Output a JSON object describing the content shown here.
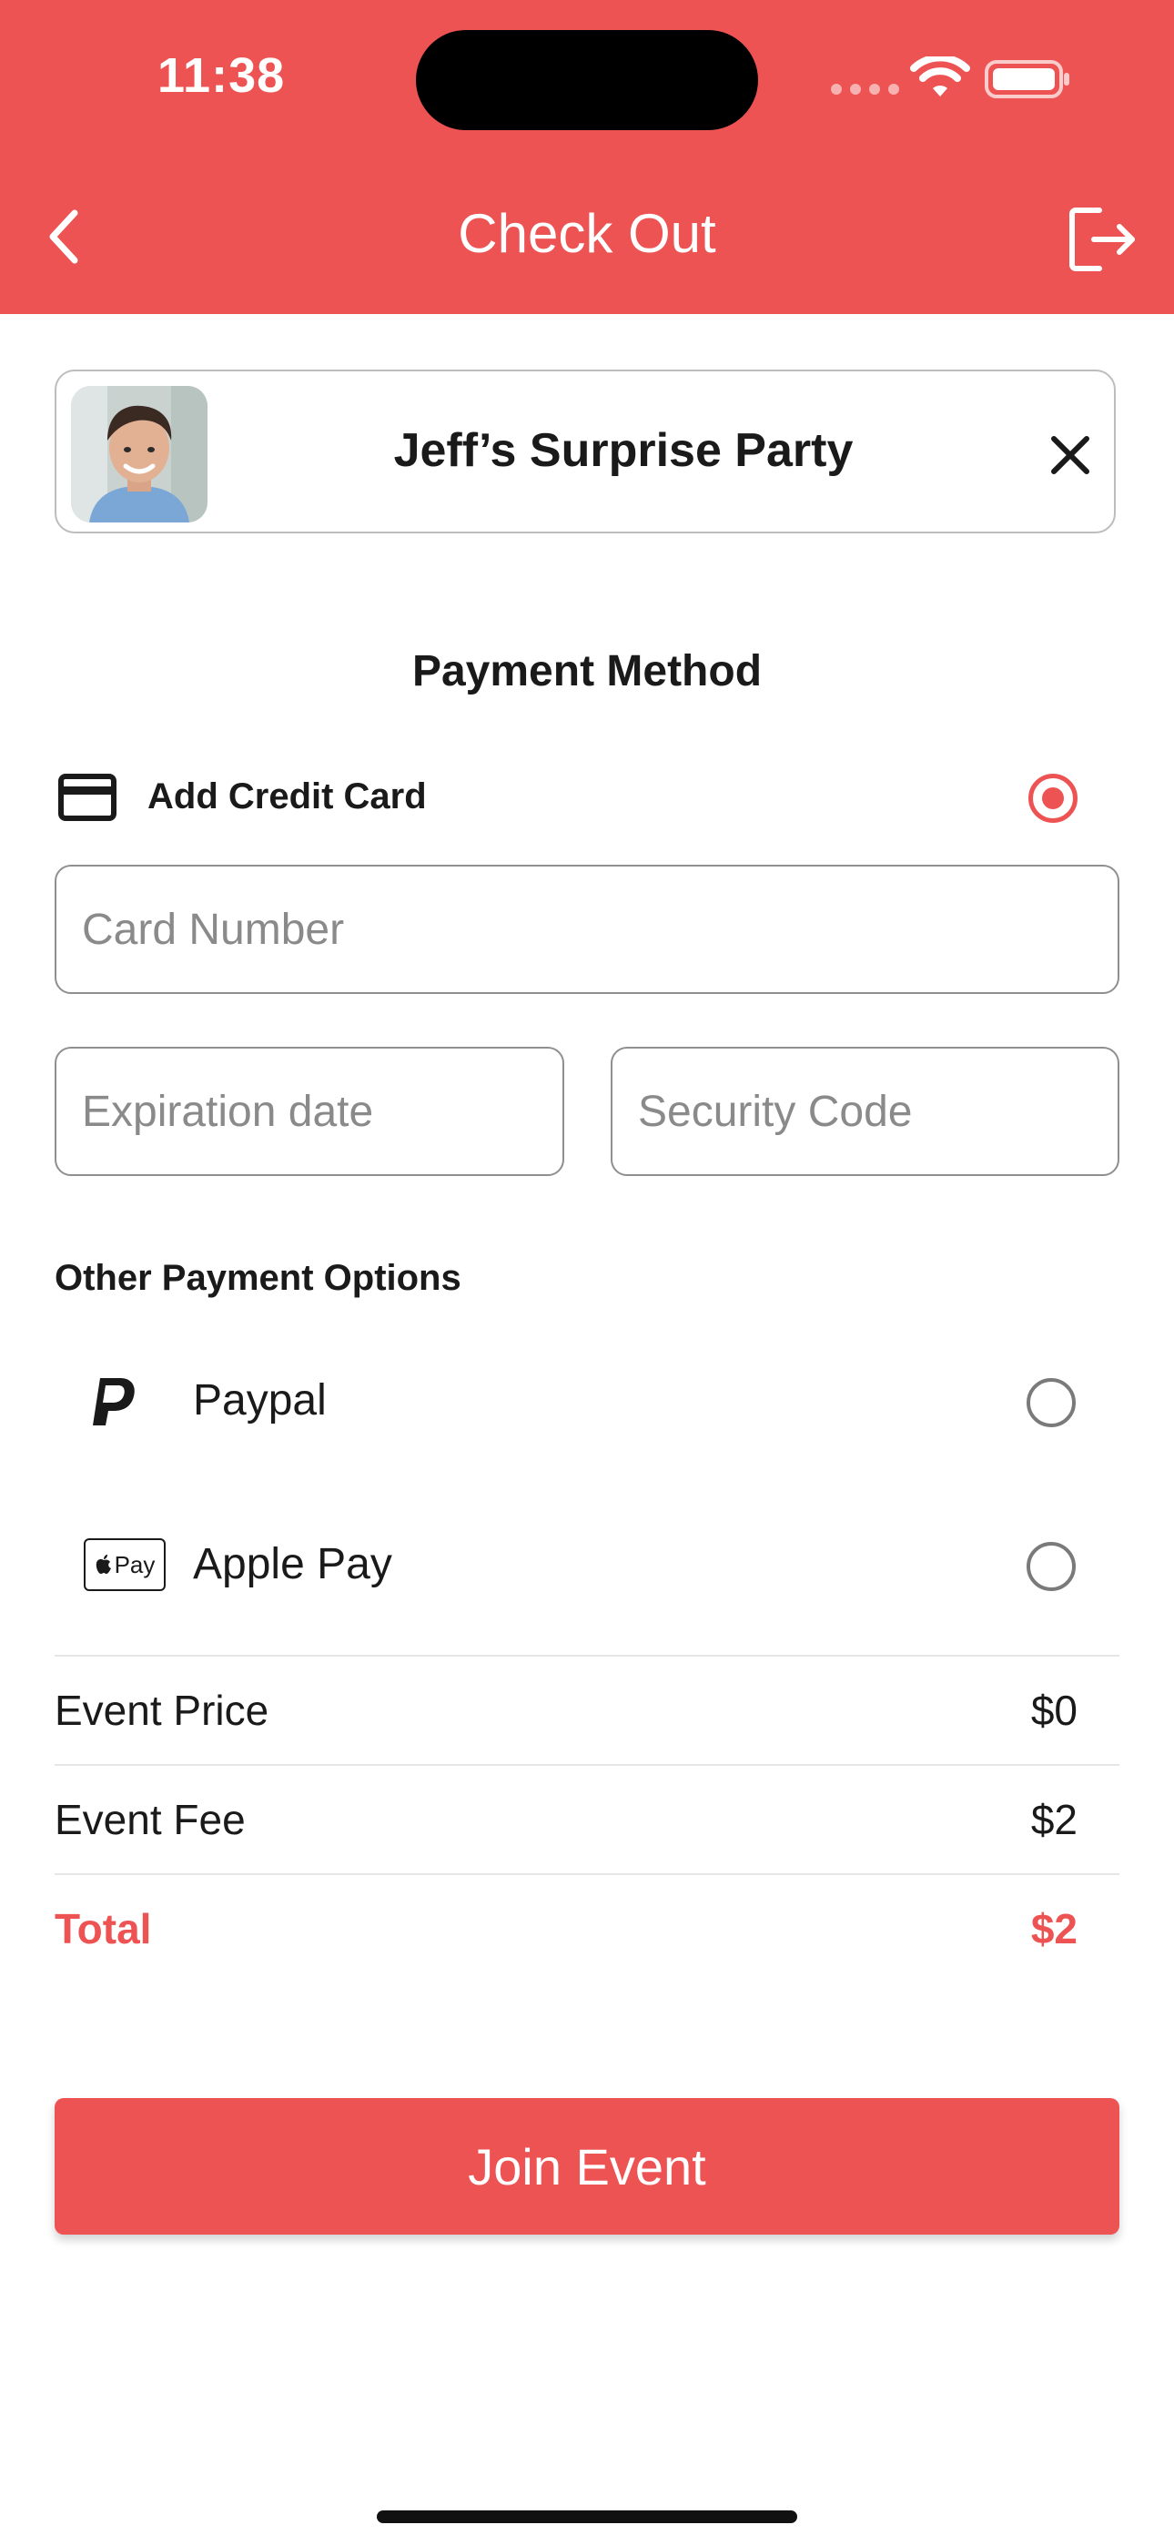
{
  "status_bar": {
    "time": "11:38"
  },
  "header": {
    "title": "Check Out",
    "background_color": "#ee5353"
  },
  "event": {
    "title": "Jeff’s Surprise Party"
  },
  "payment": {
    "section_title": "Payment Method",
    "credit_card": {
      "label": "Add Credit Card",
      "selected": true,
      "icon": "credit-card-icon"
    },
    "fields": {
      "card_number_placeholder": "Card Number",
      "expiration_placeholder": "Expiration date",
      "security_placeholder": "Security Code"
    },
    "other_title": "Other Payment Options",
    "options": [
      {
        "label": "Paypal",
        "selected": false,
        "icon": "paypal-icon"
      },
      {
        "label": "Apple Pay",
        "selected": false,
        "icon": "apple-pay-icon",
        "badge_text": "Pay"
      }
    ]
  },
  "summary": {
    "rows": [
      {
        "label": "Event Price",
        "value": "$0"
      },
      {
        "label": "Event Fee",
        "value": "$2"
      },
      {
        "label": "Total",
        "value": "$2"
      }
    ]
  },
  "actions": {
    "join_label": "Join Event"
  },
  "colors": {
    "accent": "#ee5353",
    "text": "#1a1a1a",
    "border": "#8f8f8f"
  }
}
